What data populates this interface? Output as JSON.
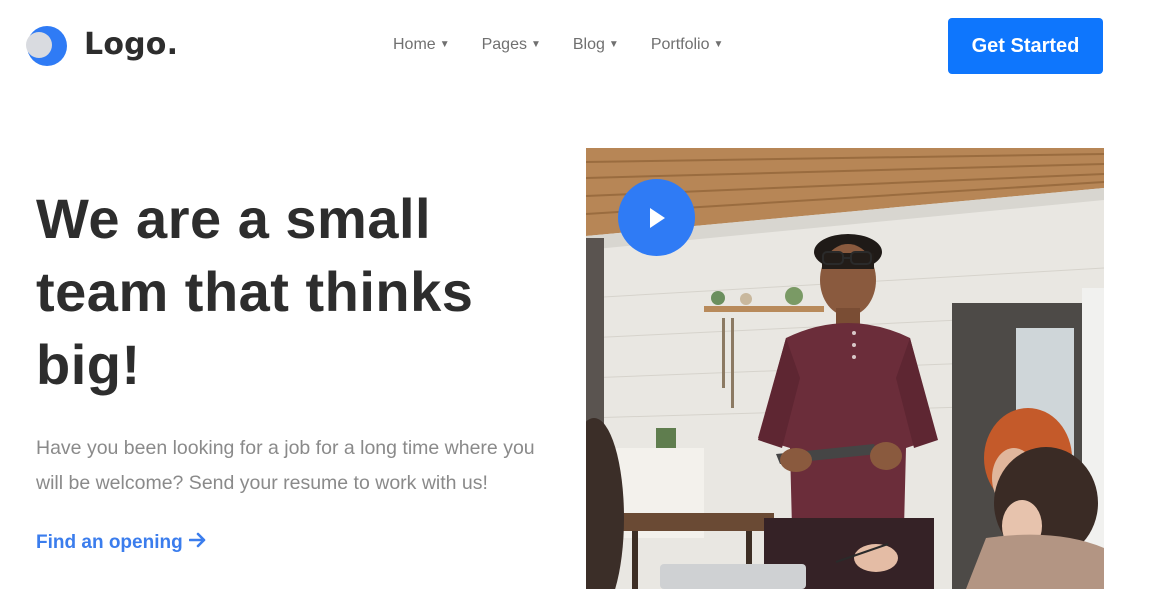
{
  "brand": {
    "logo_text": "Logo.",
    "accent_color": "#0e76fd",
    "logo_icon": "crescent-circle-logo-icon"
  },
  "nav": {
    "items": [
      {
        "label": "Home",
        "icon": "caret-down-icon"
      },
      {
        "label": "Pages",
        "icon": "caret-down-icon"
      },
      {
        "label": "Blog",
        "icon": "caret-down-icon"
      },
      {
        "label": "Portfolio",
        "icon": "caret-down-icon"
      }
    ],
    "cta_label": "Get Started"
  },
  "hero": {
    "title_lines": [
      "We are a small",
      "team that thinks",
      "big!"
    ],
    "description": "Have you been looking for a job for a long time where you will be welcome? Send your resume to work with us!",
    "link_label": "Find an opening",
    "link_icon": "arrow-right-icon",
    "link_color": "#3b7ded",
    "video_play_icon": "play-icon"
  }
}
